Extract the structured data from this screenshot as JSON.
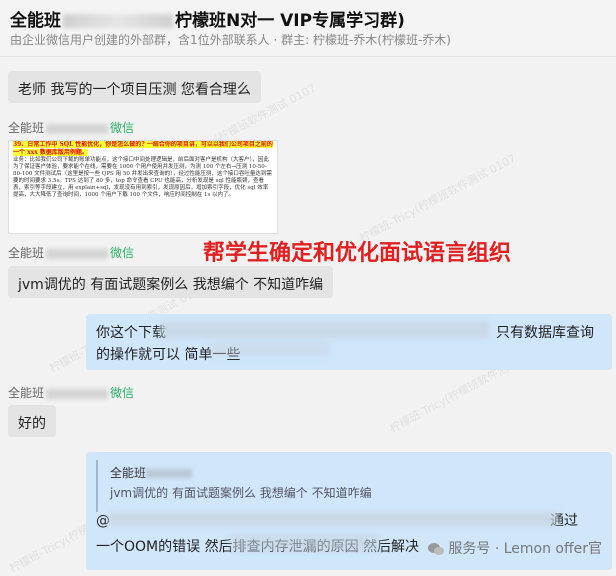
{
  "header": {
    "title_prefix": "全能班",
    "title_suffix": "柠檬班N对一 VIP专属学习群)",
    "subtitle": "由企业微信用户创建的外部群，含1位外部联系人 · 群主: 柠檬班-乔木(柠檬班-乔木)"
  },
  "messages": [
    {
      "text": "老师 我写的一个项目压测  您看合理么"
    },
    {
      "sender_prefix": "全能班",
      "sender_suffix": "微信"
    },
    {
      "sender_prefix": "全能班",
      "sender_suffix": "微信",
      "text": "jvm调优的  有面试题案例么  我想编个  不知道咋编"
    },
    {
      "text": "你这个下载",
      "text_tail": "只有数据库查询的操作就可以 简单一些"
    },
    {
      "sender_prefix": "全能班",
      "sender_suffix": "微信",
      "text": "好的"
    }
  ],
  "doc": {
    "heading": "39、日常工作中 SQL 性能优化，你是怎么做的? 一结合你的项目讲，可以以我们公司项目之前的一个 xxx 数据库版用例题。",
    "body": "业务：比如我们公司下载的账单功能点，这个接口中间处理逻辑是，前后面对客户是机构（大客户），因此为了保证客户体验，要求能个在线，需要在 1000 个用户使用并发压测，为测 100 个左右→压测 10-50-80-100 文件测试后（这里是按一些 QPS 用 50 并发出来查询的），经过性能压测，这个接口吞吐量达到需要的时间要求 3.5s。TPS 达到了 80 多，top 命令查看 CPU 也能高，分析发现是 sql 性能瓶颈，查看表，索引等字段建立，用 explain+sql，发现没有用到索引，发现原因后，增加索引字段，优化 sql 效率提高，大大降低了查询时间，1000 个用户下载 100 个文件，响应时间控制在 1s 以内了。"
  },
  "overlay_text": "帮学生确定和优化面试语言组织",
  "quote": {
    "sender": "全能班",
    "quoted_text": "jvm调优的  有面试题案例么  我想编个  不知道咋编",
    "line2_tail": "通过",
    "line3": "一个OOM的错误 然后排查内存泄漏的原因 然后解决"
  },
  "watermark": "服务号 · Lemon offer官",
  "watermark_bg": "柠檬班-Tricy(柠檬班软件测试 0107"
}
